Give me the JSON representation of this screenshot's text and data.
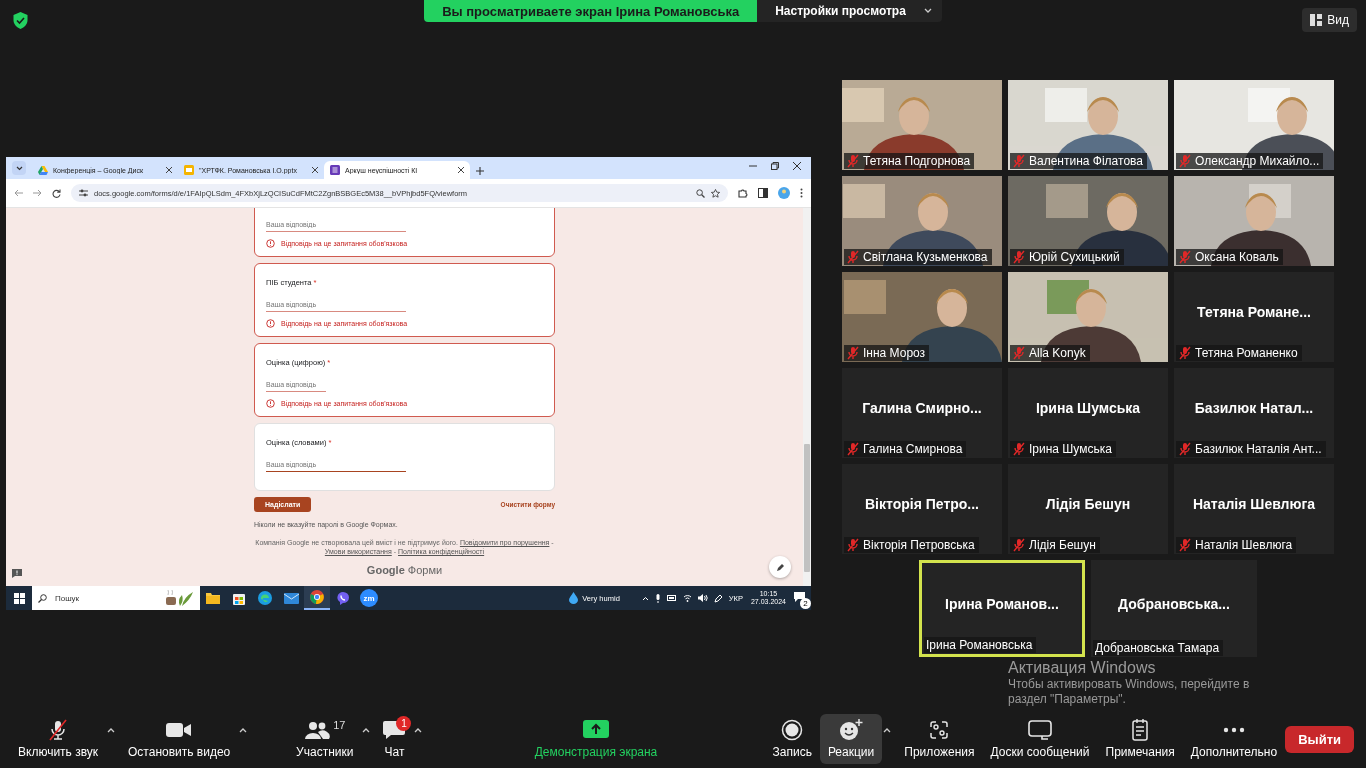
{
  "top_bar": {
    "banner": "Вы просматриваете экран Ірина Романовська",
    "view_options": "Настройки просмотра",
    "view_button": "Вид"
  },
  "shared_screen": {
    "browser": {
      "tabs": [
        {
          "title": "Конференція – Google Диск",
          "kind": "drive",
          "selected": false
        },
        {
          "title": "\"ХРТФК. Романовська І.О.pptx",
          "kind": "slides",
          "selected": false
        },
        {
          "title": "Аркуш неуспішності КІ",
          "kind": "forms",
          "selected": true
        }
      ],
      "url": "docs.google.com/forms/d/e/1FAIpQLSdm_4FXbXjLzQCISuCdFMtC2ZgnBSBGEc5M38__bVPhjbd5FQ/viewform"
    },
    "form": {
      "questions": [
        {
          "placeholder": "Ваша відповідь",
          "error": "Відповідь на це запитання обов'язкова",
          "focused": false,
          "short": false
        },
        {
          "title": "ПІБ студента",
          "required_mark": "*",
          "placeholder": "Ваша відповідь",
          "error": "Відповідь на це запитання обов'язкова",
          "focused": false,
          "short": false
        },
        {
          "title": "Оцінка (цифрою)",
          "required_mark": "*",
          "placeholder": "Ваша відповідь",
          "error": "Відповідь на це запитання обов'язкова",
          "focused": false,
          "short": true
        },
        {
          "title": "Оцінка (словами)",
          "required_mark": "*",
          "placeholder": "Ваша відповідь",
          "focused": true,
          "short": false
        }
      ],
      "submit": "Надіслати",
      "clear": "Очистити форму",
      "password_note": "Ніколи не вказуйте паролі в Google Формах.",
      "disclaimer": "Компанія Google не створювала цей вміст і не підтримує його.",
      "links": [
        "Повідомити про порушення",
        "Умови використання",
        "Політика конфіденційності"
      ],
      "link_separator": "-",
      "brand": "Google",
      "brand_product": "Форми"
    },
    "taskbar": {
      "search": "Пошук",
      "apps": [
        {
          "kind": "explorer",
          "active": false
        },
        {
          "kind": "store",
          "active": false
        },
        {
          "kind": "edge",
          "active": false
        },
        {
          "kind": "mail",
          "active": false
        },
        {
          "kind": "chrome",
          "active": true
        },
        {
          "kind": "viber",
          "active": false
        },
        {
          "kind": "zoom",
          "label": "zm",
          "active": false
        }
      ],
      "weather": "Very humid",
      "language": "УКР",
      "time": "10:15",
      "date": "27.03.2024",
      "notifications": "2"
    }
  },
  "participants": [
    {
      "name": "Тетяна Подгорнова",
      "kind": "video",
      "muted": true,
      "speaking": false
    },
    {
      "name": "Валентина Філатова",
      "kind": "video",
      "muted": true,
      "speaking": false
    },
    {
      "name": "Олександр Михайло...",
      "kind": "video",
      "muted": true,
      "speaking": false
    },
    {
      "name": "Світлана Кузьменкова",
      "kind": "video",
      "muted": true,
      "speaking": false
    },
    {
      "name": "Юрій Сухицький",
      "kind": "video",
      "muted": true,
      "speaking": false
    },
    {
      "name": "Оксана Коваль",
      "kind": "video",
      "muted": true,
      "speaking": false
    },
    {
      "name": "Інна Мороз",
      "kind": "video",
      "muted": true,
      "speaking": false
    },
    {
      "name": "Alla Konyk",
      "kind": "video",
      "muted": true,
      "speaking": false
    },
    {
      "name": "Тетяна Романенко",
      "kind": "name",
      "display": "Тетяна Романе...",
      "muted": true,
      "speaking": false
    },
    {
      "name": "Галина Смирнова",
      "kind": "name",
      "display": "Галина Смирно...",
      "muted": true,
      "speaking": false
    },
    {
      "name": "Ірина Шумська",
      "kind": "name",
      "display": "Ірина Шумська",
      "muted": true,
      "speaking": false
    },
    {
      "name": "Базилюк Наталія Ант...",
      "kind": "name",
      "display": "Базилюк Натал...",
      "muted": true,
      "speaking": false
    },
    {
      "name": "Вікторія Петровська",
      "kind": "name",
      "display": "Вікторія Петро...",
      "muted": true,
      "speaking": false
    },
    {
      "name": "Лідія Бешун",
      "kind": "name",
      "display": "Лідія Бешун",
      "muted": true,
      "speaking": false
    },
    {
      "name": "Наталія Шевлюга",
      "kind": "name",
      "display": "Наталія Шевлюга",
      "muted": true,
      "speaking": false
    },
    {
      "name": "Ірина Романовська",
      "kind": "name",
      "display": "Ірина Романов...",
      "muted": false,
      "speaking": true
    },
    {
      "name": "Добрановська Тамара",
      "kind": "name",
      "display": "Добрановська...",
      "muted": false,
      "speaking": false
    }
  ],
  "activation_notice": {
    "title": "Активация Windows",
    "lines": [
      "Чтобы активировать Windows, перейдите в",
      "раздел \"Параметры\"."
    ]
  },
  "toolbar": {
    "items": [
      {
        "kind": "mic",
        "label": "Включить звук",
        "caret": true,
        "selected": false
      },
      {
        "kind": "video",
        "label": "Остановить видео",
        "caret": true,
        "selected": false
      },
      {
        "kind": "participants",
        "label": "Участники",
        "count": "17",
        "caret": true,
        "selected": false
      },
      {
        "kind": "chat",
        "label": "Чат",
        "badge": "1",
        "caret": true,
        "selected": false
      },
      {
        "kind": "share",
        "label": "Демонстрация экрана",
        "caret": false,
        "selected": false
      },
      {
        "kind": "record",
        "label": "Запись",
        "caret": false,
        "selected": false
      },
      {
        "kind": "reactions",
        "label": "Реакции",
        "caret": true,
        "selected": true
      },
      {
        "kind": "apps",
        "label": "Приложения",
        "caret": false,
        "selected": false
      },
      {
        "kind": "whiteboards",
        "label": "Доски сообщений",
        "caret": false,
        "selected": false
      },
      {
        "kind": "notes",
        "label": "Примечания",
        "caret": false,
        "selected": false
      },
      {
        "kind": "more",
        "label": "Дополнительно",
        "caret": false,
        "selected": false
      }
    ],
    "leave": "Выйти"
  }
}
